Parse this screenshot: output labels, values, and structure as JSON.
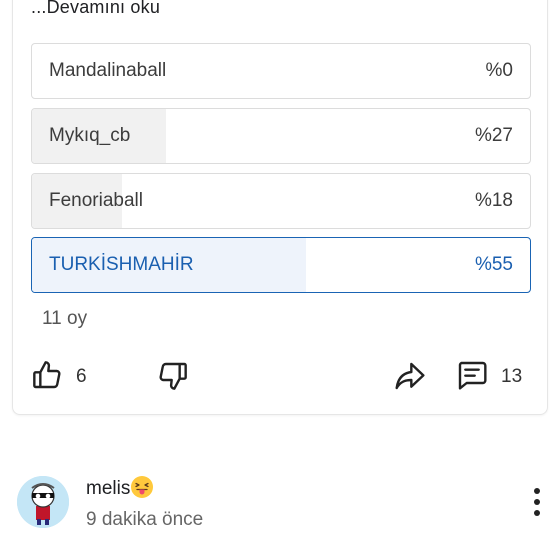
{
  "post": {
    "read_more": "...Devamını oku"
  },
  "poll": {
    "options": [
      {
        "label": "Mandalinaball",
        "percent": "%0",
        "fraction": 0.0,
        "selected": false
      },
      {
        "label": "Mykıq_cb",
        "percent": "%27",
        "fraction": 0.27,
        "selected": false
      },
      {
        "label": "Fenoriaball",
        "percent": "%18",
        "fraction": 0.18,
        "selected": false
      },
      {
        "label": "TURKİSHMAHİR",
        "percent": "%55",
        "fraction": 0.55,
        "selected": true
      }
    ],
    "votes_label": "11 oy"
  },
  "actions": {
    "like_count": "6",
    "comment_count": "13",
    "icons": [
      "thumbs-up-icon",
      "thumbs-down-icon",
      "share-icon",
      "comment-icon"
    ]
  },
  "comment": {
    "username": "melis",
    "emoji": "squinting-face-with-tongue",
    "time": "9 dakika önce"
  },
  "colors": {
    "accent": "#1a64b4",
    "selected_fill": "#eef3fb",
    "bar_fill": "#f1f1f1"
  }
}
